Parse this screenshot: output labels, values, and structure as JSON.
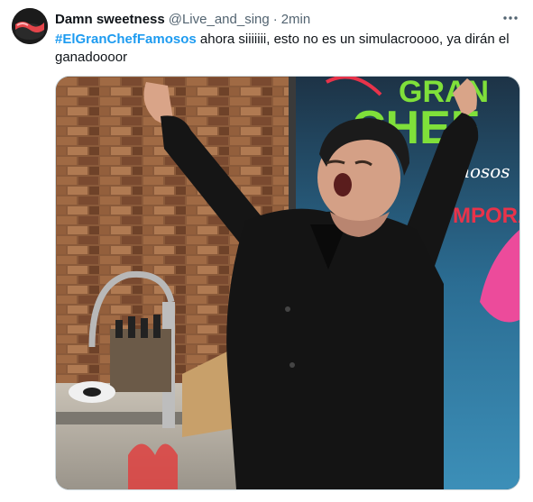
{
  "tweet": {
    "display_name": "Damn sweetness",
    "handle": "@Live_and_sing",
    "separator": "·",
    "time": "2min",
    "hashtag": "#ElGranChefFamosos",
    "body": " ahora siiiiiii, esto no es un simulacroooo, ya dirán el ganadoooor"
  },
  "media": {
    "logo_line1": "GRAN",
    "logo_line2": "CHEF",
    "logo_line3": "mosos",
    "logo_line4": "MPORA"
  },
  "icons": {
    "more": "more-horizontal-icon"
  },
  "colors": {
    "hashtag": "#1d9bf0",
    "secondary_text": "#536471",
    "logo_green": "#7fe03a",
    "logo_red": "#e8334a"
  }
}
